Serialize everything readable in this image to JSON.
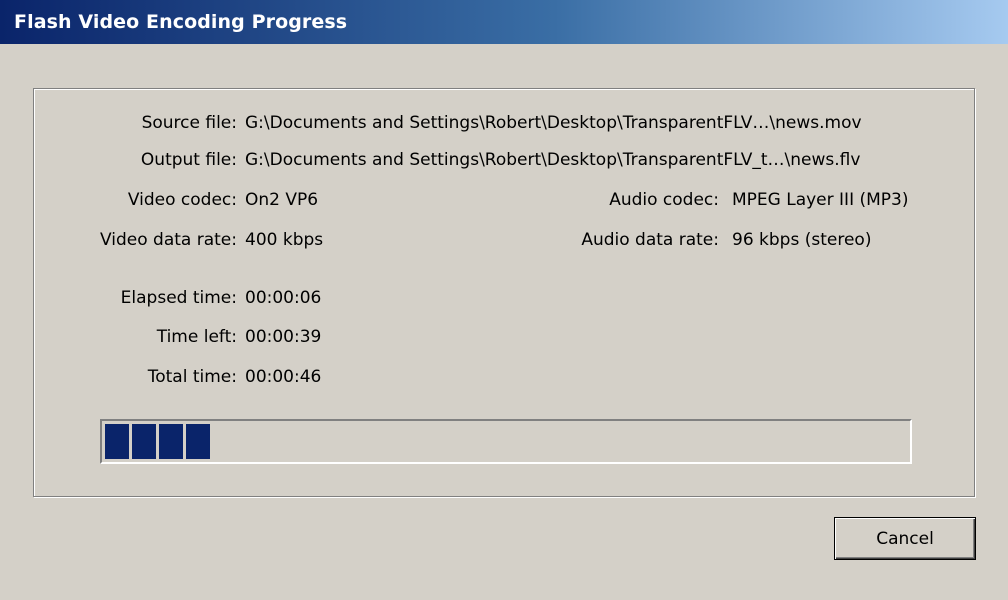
{
  "window": {
    "title": "Flash Video Encoding Progress"
  },
  "info": {
    "source_file": {
      "label": "Source file:",
      "value": "G:\\Documents and Settings\\Robert\\Desktop\\TransparentFLV…\\news.mov"
    },
    "output_file": {
      "label": "Output file:",
      "value": "G:\\Documents and Settings\\Robert\\Desktop\\TransparentFLV_t…\\news.flv"
    },
    "video_codec": {
      "label": "Video codec:",
      "value": "On2 VP6"
    },
    "audio_codec": {
      "label": "Audio codec:",
      "value": "MPEG Layer III (MP3)"
    },
    "video_data_rate": {
      "label": "Video data rate:",
      "value": "400 kbps"
    },
    "audio_data_rate": {
      "label": "Audio data rate:",
      "value": "96 kbps (stereo)"
    },
    "elapsed_time": {
      "label": "Elapsed time:",
      "value": "00:00:06"
    },
    "time_left": {
      "label": "Time left:",
      "value": "00:00:39"
    },
    "total_time": {
      "label": "Total time:",
      "value": "00:00:46"
    }
  },
  "progress": {
    "fraction": 0.14,
    "color": "#0a246a"
  },
  "buttons": {
    "cancel_label": "Cancel"
  }
}
